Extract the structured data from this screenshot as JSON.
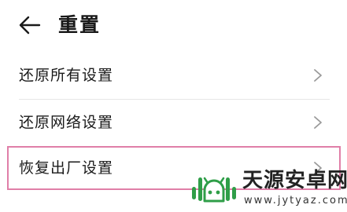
{
  "header": {
    "title": "重置",
    "back_icon": "arrow-left-icon"
  },
  "menu": {
    "items": [
      {
        "label": "还原所有设置",
        "icon": "chevron-right-icon"
      },
      {
        "label": "还原网络设置",
        "icon": "chevron-right-icon"
      },
      {
        "label": "恢复出厂设置",
        "icon": "chevron-right-icon",
        "highlighted": true
      }
    ]
  },
  "watermark": {
    "name": "天源安卓网",
    "url": "www.jytyaz.com"
  },
  "colors": {
    "text": "#1a1a1a",
    "chevron": "#9a9a9a",
    "divider": "#e6e6e6",
    "highlight": "#e07fa8",
    "logo_green": "#2f9e48"
  }
}
